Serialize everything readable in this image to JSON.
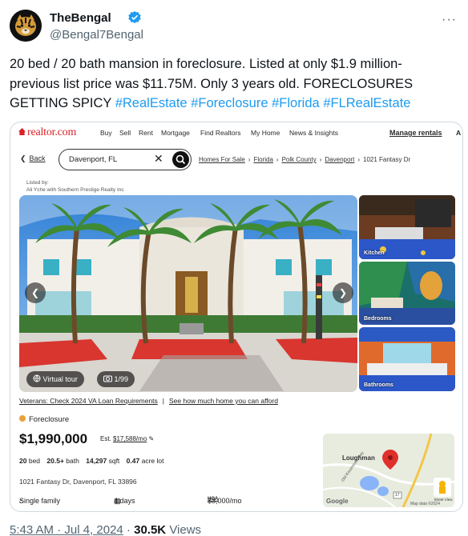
{
  "tweet": {
    "display_name": "TheBengal",
    "handle": "@Bengal7Bengal",
    "text_lines": [
      "20 bed / 20 bath mansion in foreclosure. Listed at only $1.9 million-",
      "previous list price was $11.75M. Only 3 years old. FORECLOSURES",
      "GETTING SPICY "
    ],
    "hashtags": [
      "#RealEstate",
      "#Foreclosure",
      "#Florida",
      "#FLRealEstate"
    ],
    "timestamp": "5:43 AM · Jul 4, 2024",
    "views_count": "30.5K",
    "views_label": "Views"
  },
  "listing": {
    "logo": "realtor.com",
    "nav": [
      "Buy",
      "Sell",
      "Rent",
      "Mortgage",
      "Find Realtors",
      "My Home",
      "News & Insights"
    ],
    "manage_rentals": "Manage rentals",
    "nav_extra": "A",
    "back_label": "Back",
    "search_value": "Davenport, FL",
    "breadcrumbs": [
      "Homes For Sale",
      "Florida",
      "Polk County",
      "Davenport"
    ],
    "breadcrumb_current": "1021 Fantasy Dr",
    "listed_by_label": "Listed by:",
    "listed_by_agent": "Ali Yche with Southern Prestige Realty Inc",
    "thumbnails": [
      "Kitchen",
      "Bedrooms",
      "Bathrooms"
    ],
    "virtual_tour": "Virtual tour",
    "photo_count": "1/99",
    "veterans_link": "Veterans: Check 2024 VA Loan Requirements",
    "afford_link": "See how much home you can afford",
    "status": "Foreclosure",
    "price": "$1,990,000",
    "est_label": "Est.",
    "est_payment": "$17,588/mo",
    "beds": "20",
    "beds_label": "bed",
    "baths": "20.5+",
    "baths_label": "bath",
    "sqft": "14,297",
    "sqft_label": "sqft",
    "lot": "0.47",
    "lot_label": "acre lot",
    "address": "1021 Fantasy Dr, Davenport, FL 33896",
    "property_type": "Single family",
    "days_on_market": "4 days",
    "hoa": "$3,000/mo",
    "map_label": "Loughman",
    "map_road": "Old Kissimmee Hwy",
    "map_highway": "17",
    "map_street_view": "Street View",
    "map_data": "Map data ©2024",
    "map_google": "Google"
  },
  "colors": {
    "accent_blue": "#1d9bf0",
    "realtor_red": "#d92228",
    "foreclosure_dot": "#e8a23a",
    "muted": "#536471"
  },
  "icons": [
    "verified-badge-icon",
    "more-icon",
    "back-chevron-icon",
    "clear-icon",
    "search-icon",
    "chevron-left-icon",
    "chevron-right-icon",
    "globe-icon",
    "camera-icon",
    "edit-pencil-icon",
    "house-icon",
    "calendar-icon",
    "hoa-icon",
    "map-pin-icon"
  ]
}
